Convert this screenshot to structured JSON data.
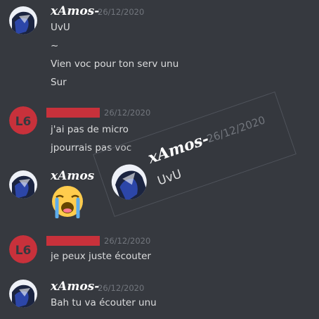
{
  "messages": [
    {
      "username": "xAmos-",
      "timestamp": "26/12/2020",
      "lines": [
        "UvU",
        "~",
        "Vien voc pour ton serv unu",
        "Sur"
      ]
    },
    {
      "username": "",
      "avatar_text": "L6",
      "timestamp": "26/12/2020",
      "lines": [
        "j'ai pas de micro",
        "jpourrais pas voc"
      ]
    },
    {
      "username": "xAmos",
      "timestamp": "",
      "emoji": "loudly-crying-face"
    },
    {
      "username": "",
      "avatar_text": "L6",
      "timestamp": "26/12/2020",
      "lines": [
        "je peux juste écouter"
      ]
    },
    {
      "username": "xAmos-",
      "timestamp": "26/12/2020",
      "lines": [
        "Bah tu va écouter unu"
      ]
    }
  ],
  "overlay": {
    "username": "xAmos-",
    "timestamp": "26/12/2020",
    "message": "UvU"
  },
  "colors": {
    "background": "#36393f",
    "redacted": "#c8313b",
    "l6_avatar": "#c8313b",
    "timestamp": "#72767d",
    "text": "#dcddde"
  }
}
